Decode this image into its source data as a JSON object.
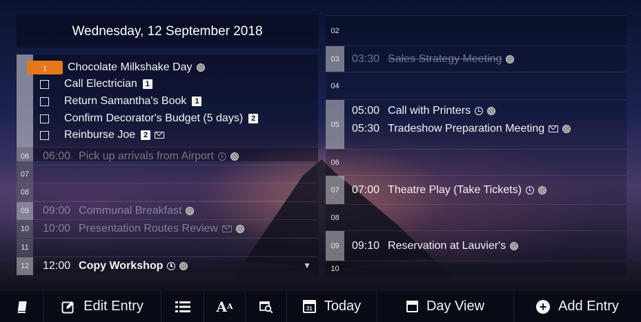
{
  "header": {
    "date": "Wednesday, 12 September 2018"
  },
  "allday": [
    {
      "label": "Chocolate Milkshake Day",
      "kind": "holiday",
      "marker": "↕",
      "icons": [
        "dot"
      ]
    },
    {
      "label": "Call Electrician",
      "kind": "task",
      "badge": "1",
      "icons": []
    },
    {
      "label": "Return Samantha's Book",
      "kind": "task",
      "badge": "1",
      "icons": []
    },
    {
      "label": "Confirm Decorator's Budget (5 days)",
      "kind": "task",
      "badge": "2",
      "icons": []
    },
    {
      "label": "Reinburse Joe",
      "kind": "task",
      "badge": "2",
      "icons": [
        "mail"
      ]
    }
  ],
  "left_hours": [
    {
      "hour": "06",
      "time": "06:00",
      "title": "Pick up arrivals from Airport",
      "style": "past",
      "icons": [
        "alarm",
        "dot"
      ]
    },
    {
      "hour": "07",
      "time": "",
      "title": "",
      "style": "",
      "icons": []
    },
    {
      "hour": "08",
      "time": "",
      "title": "",
      "style": "",
      "icons": []
    },
    {
      "hour": "09",
      "time": "09:00",
      "title": "Communal Breakfast",
      "style": "past",
      "icons": [
        "dot"
      ]
    },
    {
      "hour": "10",
      "time": "10:00",
      "title": "Presentation Routes Review",
      "style": "past",
      "icons": [
        "mail",
        "dot"
      ]
    },
    {
      "hour": "11",
      "time": "",
      "title": "",
      "style": "",
      "icons": []
    },
    {
      "hour": "12",
      "time": "12:00",
      "title": "Copy Workshop",
      "style": "bold",
      "icons": [
        "alarm",
        "dot"
      ]
    }
  ],
  "right_hours": [
    {
      "hour": "02",
      "events": []
    },
    {
      "hour": "03",
      "events": [
        {
          "time": "03:30",
          "title": "Sales Strategy Meeting",
          "style": "struck",
          "icons": [
            "dot"
          ]
        }
      ]
    },
    {
      "hour": "04",
      "events": []
    },
    {
      "hour": "05",
      "events": [
        {
          "time": "05:00",
          "title": "Call with Printers",
          "style": "",
          "icons": [
            "alarm",
            "dot"
          ]
        },
        {
          "time": "05:30",
          "title": "Tradeshow Preparation Meeting",
          "style": "",
          "icons": [
            "mail",
            "dot"
          ]
        }
      ]
    },
    {
      "hour": "06",
      "events": []
    },
    {
      "hour": "07",
      "events": [
        {
          "time": "07:00",
          "title": "Theatre Play (Take Tickets)",
          "style": "",
          "icons": [
            "alarm",
            "dot"
          ]
        }
      ]
    },
    {
      "hour": "08",
      "events": []
    },
    {
      "hour": "09",
      "events": [
        {
          "time": "09:10",
          "title": "Reservation at Lauvier's",
          "style": "",
          "icons": [
            "dot"
          ]
        }
      ]
    },
    {
      "hour": "10",
      "events": []
    }
  ],
  "toolbar": {
    "book_icon": "book-icon",
    "edit_label": "Edit Entry",
    "list_icon": "list-icon",
    "font_icon": "font-size-icon",
    "search_icon": "calendar-search-icon",
    "today_label": "Today",
    "today_day": "31",
    "dayview_label": "Day View",
    "add_label": "Add Entry"
  },
  "colors": {
    "accent": "#e8771c"
  }
}
